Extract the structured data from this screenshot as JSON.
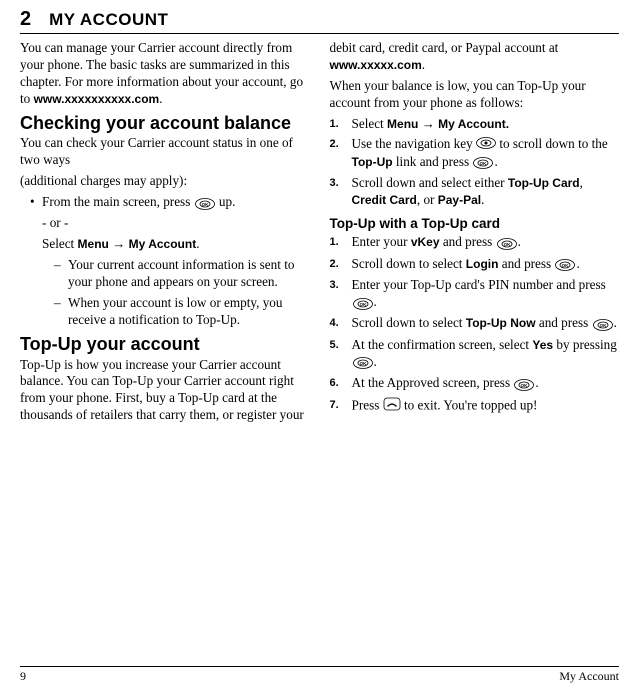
{
  "chapter": {
    "number": "2",
    "title": "MY ACCOUNT"
  },
  "intro": {
    "text1": "You can manage your Carrier account directly from your phone. The basic tasks are summarized in this chapter. For more information about your account, go to ",
    "url": "www.xxxxxxxxxx.com",
    "period": "."
  },
  "section1": {
    "heading": "Checking your account balance",
    "para1": "You can check your Carrier account status in one of two ways",
    "para2": "(additional charges may apply):",
    "bullet1_pre": "From the main screen, press ",
    "bullet1_post": " up.",
    "or": "- or -",
    "select_pre": "Select ",
    "menu": "Menu",
    "arrow": " → ",
    "myaccount": "My Account",
    "select_post": ".",
    "dash1": "Your current account information is sent to your phone and appears on your screen.",
    "dash2": "When your account is low or empty, you receive a notification to Top-Up."
  },
  "section2": {
    "heading": "Top-Up your account",
    "para_pre": "Top-Up is how you increase your Carrier account balance. You can Top-Up your Carrier account right from your phone. First, buy a Top-Up card at the thousands of retailers that carry them, or register your debit card, credit card, or Paypal account at ",
    "url": "www.xxxxx.com",
    "para_post": "."
  },
  "col2": {
    "para": "When your balance is low, you can Top-Up your account from your phone as follows:",
    "steps": {
      "n1": "1.",
      "s1_pre": "Select ",
      "s1_menu": "Menu",
      "s1_arrow": " → ",
      "s1_my": "My Account.",
      "n2": "2.",
      "s2_pre": "Use the navigation key ",
      "s2_mid": " to scroll down to the ",
      "s2_topup": "Top-Up",
      "s2_post1": " link and press ",
      "s2_post2": ".",
      "n3": "3.",
      "s3_pre": "Scroll down and select either ",
      "s3_a": "Top-Up Card",
      "s3_comma": ", ",
      "s3_b": "Credit Card",
      "s3_or": ", or ",
      "s3_c": "Pay-Pal",
      "s3_post": "."
    },
    "subheading": "Top-Up with a Top-Up card",
    "sub": {
      "n1": "1.",
      "s1_pre": "Enter your ",
      "s1_vkey": "vKey",
      "s1_post1": " and press ",
      "s1_post2": ".",
      "n2": "2.",
      "s2_pre": "Scroll down to select ",
      "s2_login": "Login",
      "s2_post1": " and press ",
      "s2_post2": ".",
      "n3": "3.",
      "s3_pre": "Enter your Top-Up card's PIN number and press ",
      "s3_post": ".",
      "n4": "4.",
      "s4_pre": "Scroll down to select ",
      "s4_now": "Top-Up Now",
      "s4_post1": " and press ",
      "s4_post2": ".",
      "n5": "5.",
      "s5_pre": "At the confirmation screen, select ",
      "s5_yes": "Yes",
      "s5_post1": " by pressing ",
      "s5_post2": ".",
      "n6": "6.",
      "s6_pre": "At the Approved screen, press ",
      "s6_post": ".",
      "n7": "7.",
      "s7_pre": "Press ",
      "s7_post": " to exit. You're topped up!"
    }
  },
  "footer": {
    "page": "9",
    "title": "My Account"
  }
}
